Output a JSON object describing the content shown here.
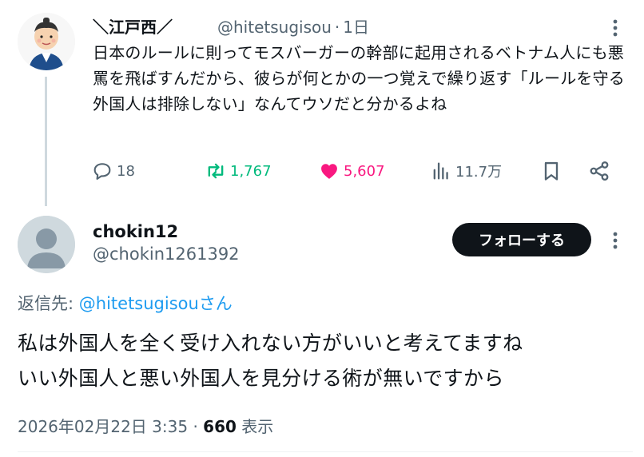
{
  "tweet": {
    "author_name": "＼江戸西／",
    "handle": "@hitetsugisou",
    "separator": "·",
    "time": "1日",
    "text": "日本のルールに則ってモスバーガーの幹部に起用されるベトナム人にも悪罵を飛ばすんだから、彼らが何とかの一つ覚えで繰り返す「ルールを守る外国人は排除しない」なんてウソだと分かるよね",
    "actions": {
      "replies": "18",
      "retweets": "1,767",
      "likes": "5,607",
      "views": "11.7万"
    }
  },
  "reply": {
    "author_name": "chokin12",
    "handle": "@chokin1261392",
    "follow_label": "フォローする",
    "reply_to_prefix": "返信先: ",
    "reply_to_mention": "@hitetsugisou",
    "reply_to_suffix": "さん",
    "text_line1": "私は外国人を全く受け入れない方がいいと考えてますね",
    "text_line2": "いい外国人と悪い外国人を見分ける術が無いですから",
    "date": "2026年02月22日 3:35",
    "separator": "·",
    "views_count": "660",
    "views_label": "表示"
  },
  "colors": {
    "accent": "#1d9bf0",
    "retweet": "#00ba7c",
    "like": "#f91880",
    "muted": "#536471",
    "text": "#0f1419"
  }
}
